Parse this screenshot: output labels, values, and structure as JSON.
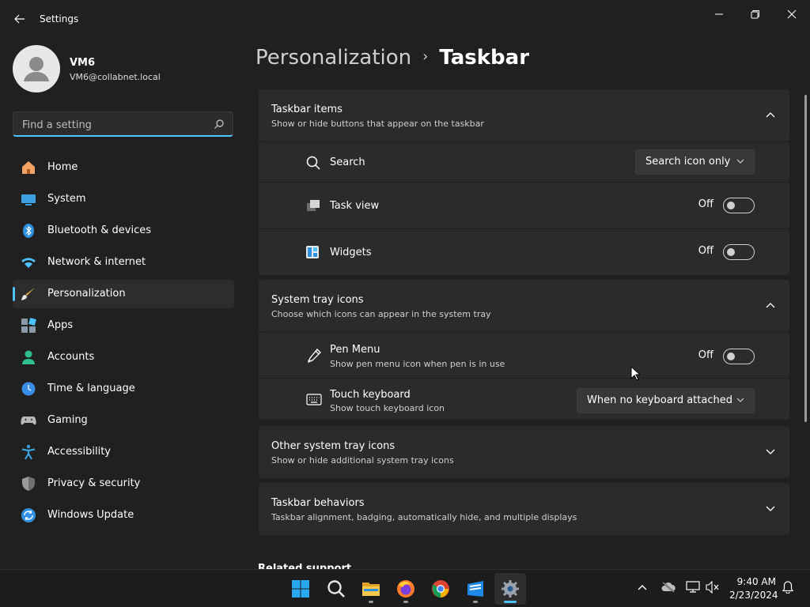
{
  "window": {
    "title": "Settings"
  },
  "profile": {
    "name": "VM6",
    "email": "VM6@collabnet.local"
  },
  "search": {
    "placeholder": "Find a setting"
  },
  "nav": {
    "items": [
      {
        "label": "Home",
        "icon": "home-icon"
      },
      {
        "label": "System",
        "icon": "system-icon"
      },
      {
        "label": "Bluetooth & devices",
        "icon": "bluetooth-icon"
      },
      {
        "label": "Network & internet",
        "icon": "wifi-icon"
      },
      {
        "label": "Personalization",
        "icon": "brush-icon",
        "active": true
      },
      {
        "label": "Apps",
        "icon": "apps-icon"
      },
      {
        "label": "Accounts",
        "icon": "accounts-icon"
      },
      {
        "label": "Time & language",
        "icon": "clock-icon"
      },
      {
        "label": "Gaming",
        "icon": "gamepad-icon"
      },
      {
        "label": "Accessibility",
        "icon": "accessibility-icon"
      },
      {
        "label": "Privacy & security",
        "icon": "shield-icon"
      },
      {
        "label": "Windows Update",
        "icon": "update-icon"
      }
    ]
  },
  "breadcrumb": {
    "parent": "Personalization",
    "separator": "›",
    "current": "Taskbar"
  },
  "sections": {
    "taskbar_items": {
      "title": "Taskbar items",
      "subtitle": "Show or hide buttons that appear on the taskbar",
      "search": {
        "label": "Search",
        "value": "Search icon only"
      },
      "task_view": {
        "label": "Task view",
        "state": "Off"
      },
      "widgets": {
        "label": "Widgets",
        "state": "Off"
      }
    },
    "system_tray": {
      "title": "System tray icons",
      "subtitle": "Choose which icons can appear in the system tray",
      "pen_menu": {
        "label": "Pen Menu",
        "subtitle": "Show pen menu icon when pen is in use",
        "state": "Off"
      },
      "touch_keyboard": {
        "label": "Touch keyboard",
        "subtitle": "Show touch keyboard icon",
        "value": "When no keyboard attached"
      }
    },
    "other_tray": {
      "title": "Other system tray icons",
      "subtitle": "Show or hide additional system tray icons"
    },
    "behaviors": {
      "title": "Taskbar behaviors",
      "subtitle": "Taskbar alignment, badging, automatically hide, and multiple displays"
    }
  },
  "related": {
    "title": "Related support"
  },
  "taskbar": {
    "apps": [
      "start-icon",
      "search-icon",
      "file-explorer-icon",
      "firefox-icon",
      "chrome-icon",
      "store-icon",
      "settings-icon"
    ],
    "clock": {
      "time": "9:40 AM",
      "date": "2/23/2024"
    }
  },
  "colors": {
    "accent": "#4cc2ff",
    "background": "#202020",
    "card": "#2b2b2b"
  }
}
